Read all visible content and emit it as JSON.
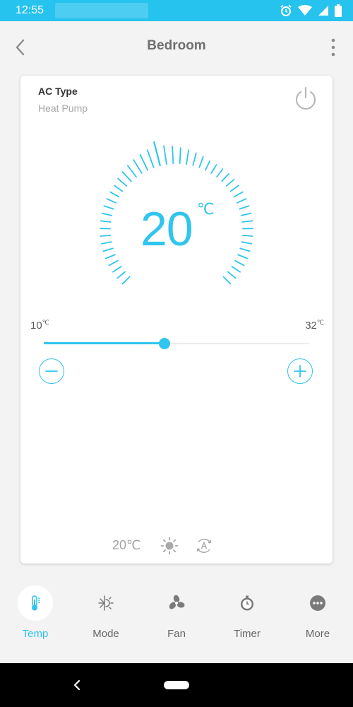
{
  "status_bar": {
    "time": "12:55",
    "icons": [
      "alarm-icon",
      "wifi-icon",
      "signal-icon",
      "battery-icon"
    ],
    "color": "#26c3ee"
  },
  "header": {
    "title": "Bedroom",
    "back_icon": "chevron-left-icon",
    "menu_icon": "more-vertical-icon"
  },
  "device": {
    "ac_type_label": "AC Type",
    "ac_type_value": "Heat Pump",
    "power_icon": "power-icon"
  },
  "thermostat": {
    "current_temp": "20",
    "unit": "℃",
    "min": "10",
    "max": "32",
    "min_unit": "℃",
    "max_unit": "℃",
    "setpoint": 20,
    "range": [
      10,
      32
    ],
    "accent": "#2fc5ee"
  },
  "summary": {
    "temp": "20℃",
    "mode_icon": "sun-icon",
    "fan_icon": "auto-fan-icon"
  },
  "tabs": [
    {
      "label": "Temp",
      "icon": "thermometer-icon",
      "active": true
    },
    {
      "label": "Mode",
      "icon": "snowflake-sun-icon",
      "active": false
    },
    {
      "label": "Fan",
      "icon": "fan-icon",
      "active": false
    },
    {
      "label": "Timer",
      "icon": "timer-icon",
      "active": false
    },
    {
      "label": "More",
      "icon": "more-horizontal-icon",
      "active": false
    }
  ]
}
